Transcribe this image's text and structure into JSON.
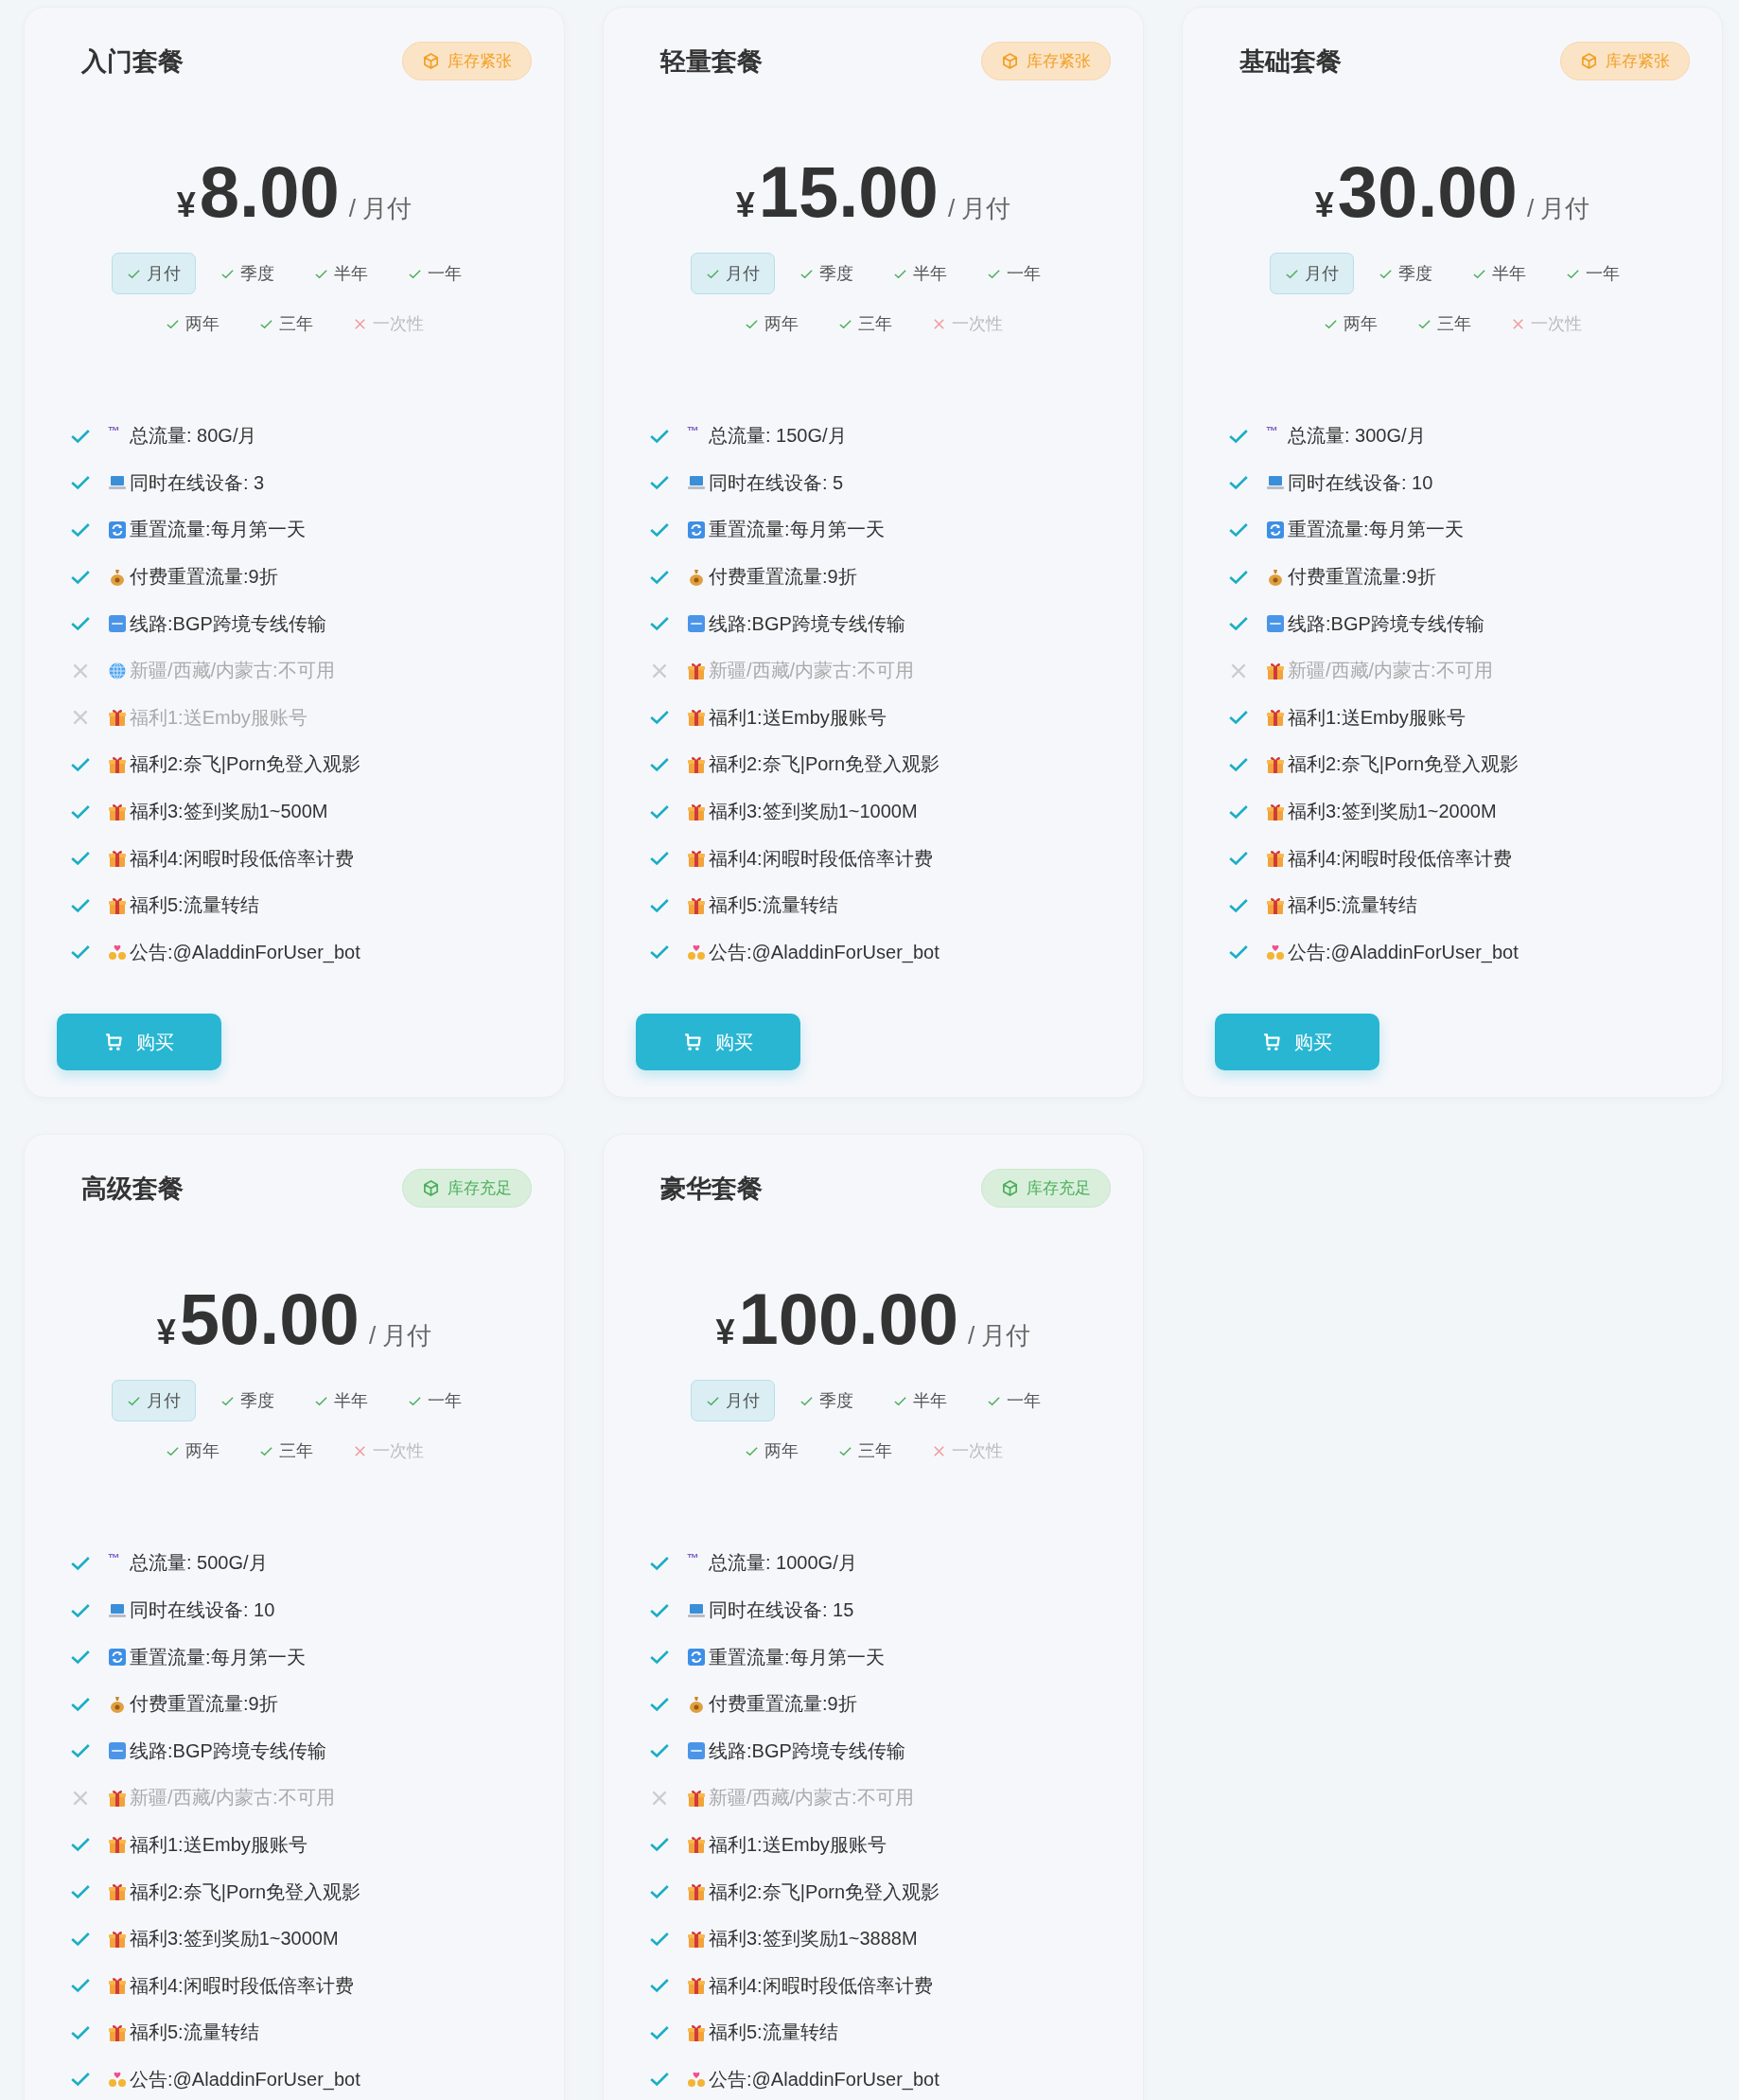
{
  "plans": [
    {
      "name": "入门套餐",
      "stock": {
        "kind": "low",
        "label": "库存紧张"
      },
      "currency": "¥",
      "price": "8.00",
      "period": "/ 月付",
      "cycles": [
        {
          "label": "月付",
          "available": true,
          "selected": true
        },
        {
          "label": "季度",
          "available": true,
          "selected": false
        },
        {
          "label": "半年",
          "available": true,
          "selected": false
        },
        {
          "label": "一年",
          "available": true,
          "selected": false
        },
        {
          "label": "两年",
          "available": true,
          "selected": false
        },
        {
          "label": "三年",
          "available": true,
          "selected": false
        },
        {
          "label": "一次性",
          "available": false,
          "selected": false
        }
      ],
      "features": [
        {
          "available": true,
          "symbol": "™",
          "text": "总流量: 80G/月"
        },
        {
          "available": true,
          "kind": "laptop",
          "text": "同时在线设备: 3"
        },
        {
          "available": true,
          "kind": "refresh",
          "text": "重置流量:每月第一天"
        },
        {
          "available": true,
          "kind": "money",
          "text": "付费重置流量:9折"
        },
        {
          "available": true,
          "kind": "atm",
          "text": "线路:BGP跨境专线传输"
        },
        {
          "available": false,
          "kind": "globe",
          "text": "新疆/西藏/内蒙古:不可用"
        },
        {
          "available": false,
          "kind": "gift",
          "text": "福利1:送Emby服账号"
        },
        {
          "available": true,
          "kind": "gift",
          "text": "福利2:奈飞|Porn免登入观影"
        },
        {
          "available": true,
          "kind": "gift",
          "text": "福利3:签到奖励1~500M"
        },
        {
          "available": true,
          "kind": "gift",
          "text": "福利4:闲暇时段低倍率计费"
        },
        {
          "available": true,
          "kind": "gift",
          "text": "福利5:流量转结"
        },
        {
          "available": true,
          "kind": "hearts",
          "text": "公告:@AladdinForUser_bot"
        }
      ],
      "buy_button": "购买"
    },
    {
      "name": "轻量套餐",
      "stock": {
        "kind": "low",
        "label": "库存紧张"
      },
      "currency": "¥",
      "price": "15.00",
      "period": "/ 月付",
      "cycles": [
        {
          "label": "月付",
          "available": true,
          "selected": true
        },
        {
          "label": "季度",
          "available": true,
          "selected": false
        },
        {
          "label": "半年",
          "available": true,
          "selected": false
        },
        {
          "label": "一年",
          "available": true,
          "selected": false
        },
        {
          "label": "两年",
          "available": true,
          "selected": false
        },
        {
          "label": "三年",
          "available": true,
          "selected": false
        },
        {
          "label": "一次性",
          "available": false,
          "selected": false
        }
      ],
      "features": [
        {
          "available": true,
          "symbol": "™",
          "text": "总流量: 150G/月"
        },
        {
          "available": true,
          "kind": "laptop",
          "text": "同时在线设备: 5"
        },
        {
          "available": true,
          "kind": "refresh",
          "text": "重置流量:每月第一天"
        },
        {
          "available": true,
          "kind": "money",
          "text": "付费重置流量:9折"
        },
        {
          "available": true,
          "kind": "atm",
          "text": "线路:BGP跨境专线传输"
        },
        {
          "available": false,
          "kind": "gift",
          "text": "新疆/西藏/内蒙古:不可用"
        },
        {
          "available": true,
          "kind": "gift",
          "text": "福利1:送Emby服账号"
        },
        {
          "available": true,
          "kind": "gift",
          "text": "福利2:奈飞|Porn免登入观影"
        },
        {
          "available": true,
          "kind": "gift",
          "text": "福利3:签到奖励1~1000M"
        },
        {
          "available": true,
          "kind": "gift",
          "text": "福利4:闲暇时段低倍率计费"
        },
        {
          "available": true,
          "kind": "gift",
          "text": "福利5:流量转结"
        },
        {
          "available": true,
          "kind": "hearts",
          "text": "公告:@AladdinForUser_bot"
        }
      ],
      "buy_button": "购买"
    },
    {
      "name": "基础套餐",
      "stock": {
        "kind": "low",
        "label": "库存紧张"
      },
      "currency": "¥",
      "price": "30.00",
      "period": "/ 月付",
      "cycles": [
        {
          "label": "月付",
          "available": true,
          "selected": true
        },
        {
          "label": "季度",
          "available": true,
          "selected": false
        },
        {
          "label": "半年",
          "available": true,
          "selected": false
        },
        {
          "label": "一年",
          "available": true,
          "selected": false
        },
        {
          "label": "两年",
          "available": true,
          "selected": false
        },
        {
          "label": "三年",
          "available": true,
          "selected": false
        },
        {
          "label": "一次性",
          "available": false,
          "selected": false
        }
      ],
      "features": [
        {
          "available": true,
          "symbol": "™",
          "text": "总流量: 300G/月"
        },
        {
          "available": true,
          "kind": "laptop",
          "text": "同时在线设备: 10"
        },
        {
          "available": true,
          "kind": "refresh",
          "text": "重置流量:每月第一天"
        },
        {
          "available": true,
          "kind": "money",
          "text": "付费重置流量:9折"
        },
        {
          "available": true,
          "kind": "atm",
          "text": "线路:BGP跨境专线传输"
        },
        {
          "available": false,
          "kind": "gift",
          "text": "新疆/西藏/内蒙古:不可用"
        },
        {
          "available": true,
          "kind": "gift",
          "text": "福利1:送Emby服账号"
        },
        {
          "available": true,
          "kind": "gift",
          "text": "福利2:奈飞|Porn免登入观影"
        },
        {
          "available": true,
          "kind": "gift",
          "text": "福利3:签到奖励1~2000M"
        },
        {
          "available": true,
          "kind": "gift",
          "text": "福利4:闲暇时段低倍率计费"
        },
        {
          "available": true,
          "kind": "gift",
          "text": "福利5:流量转结"
        },
        {
          "available": true,
          "kind": "hearts",
          "text": "公告:@AladdinForUser_bot"
        }
      ],
      "buy_button": "购买"
    },
    {
      "name": "高级套餐",
      "stock": {
        "kind": "ample",
        "label": "库存充足"
      },
      "currency": "¥",
      "price": "50.00",
      "period": "/ 月付",
      "cycles": [
        {
          "label": "月付",
          "available": true,
          "selected": true
        },
        {
          "label": "季度",
          "available": true,
          "selected": false
        },
        {
          "label": "半年",
          "available": true,
          "selected": false
        },
        {
          "label": "一年",
          "available": true,
          "selected": false
        },
        {
          "label": "两年",
          "available": true,
          "selected": false
        },
        {
          "label": "三年",
          "available": true,
          "selected": false
        },
        {
          "label": "一次性",
          "available": false,
          "selected": false
        }
      ],
      "features": [
        {
          "available": true,
          "symbol": "™",
          "text": "总流量: 500G/月"
        },
        {
          "available": true,
          "kind": "laptop",
          "text": "同时在线设备: 10"
        },
        {
          "available": true,
          "kind": "refresh",
          "text": "重置流量:每月第一天"
        },
        {
          "available": true,
          "kind": "money",
          "text": "付费重置流量:9折"
        },
        {
          "available": true,
          "kind": "atm",
          "text": "线路:BGP跨境专线传输"
        },
        {
          "available": false,
          "kind": "gift",
          "text": "新疆/西藏/内蒙古:不可用"
        },
        {
          "available": true,
          "kind": "gift",
          "text": "福利1:送Emby服账号"
        },
        {
          "available": true,
          "kind": "gift",
          "text": "福利2:奈飞|Porn免登入观影"
        },
        {
          "available": true,
          "kind": "gift",
          "text": "福利3:签到奖励1~3000M"
        },
        {
          "available": true,
          "kind": "gift",
          "text": "福利4:闲暇时段低倍率计费"
        },
        {
          "available": true,
          "kind": "gift",
          "text": "福利5:流量转结"
        },
        {
          "available": true,
          "kind": "hearts",
          "text": "公告:@AladdinForUser_bot"
        }
      ]
    },
    {
      "name": "豪华套餐",
      "stock": {
        "kind": "ample",
        "label": "库存充足"
      },
      "currency": "¥",
      "price": "100.00",
      "period": "/ 月付",
      "cycles": [
        {
          "label": "月付",
          "available": true,
          "selected": true
        },
        {
          "label": "季度",
          "available": true,
          "selected": false
        },
        {
          "label": "半年",
          "available": true,
          "selected": false
        },
        {
          "label": "一年",
          "available": true,
          "selected": false
        },
        {
          "label": "两年",
          "available": true,
          "selected": false
        },
        {
          "label": "三年",
          "available": true,
          "selected": false
        },
        {
          "label": "一次性",
          "available": false,
          "selected": false
        }
      ],
      "features": [
        {
          "available": true,
          "symbol": "™",
          "text": "总流量: 1000G/月"
        },
        {
          "available": true,
          "kind": "laptop",
          "text": "同时在线设备: 15"
        },
        {
          "available": true,
          "kind": "refresh",
          "text": "重置流量:每月第一天"
        },
        {
          "available": true,
          "kind": "money",
          "text": "付费重置流量:9折"
        },
        {
          "available": true,
          "kind": "atm",
          "text": "线路:BGP跨境专线传输"
        },
        {
          "available": false,
          "kind": "gift",
          "text": "新疆/西藏/内蒙古:不可用"
        },
        {
          "available": true,
          "kind": "gift",
          "text": "福利1:送Emby服账号"
        },
        {
          "available": true,
          "kind": "gift",
          "text": "福利2:奈飞|Porn免登入观影"
        },
        {
          "available": true,
          "kind": "gift",
          "text": "福利3:签到奖励1~3888M"
        },
        {
          "available": true,
          "kind": "gift",
          "text": "福利4:闲暇时段低倍率计费"
        },
        {
          "available": true,
          "kind": "gift",
          "text": "福利5:流量转结"
        },
        {
          "available": true,
          "kind": "hearts",
          "text": "公告:@AladdinForUser_bot"
        }
      ]
    }
  ]
}
